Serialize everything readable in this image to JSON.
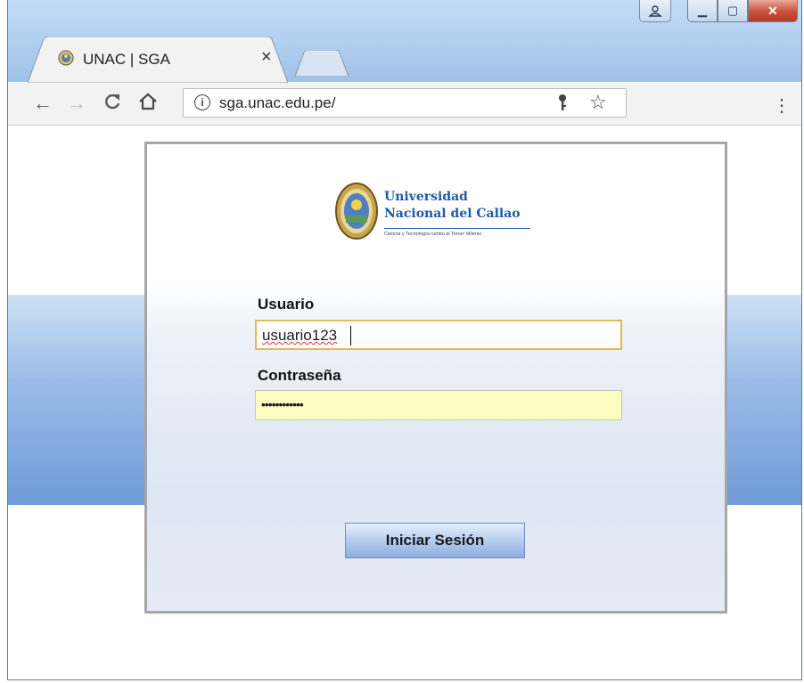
{
  "browser": {
    "tab_title": "UNAC | SGA",
    "tab_close": "×",
    "url": "sga.unac.edu.pe/",
    "info_icon": "i",
    "window_controls": {
      "minimize": "▁",
      "maximize": "▢",
      "close": "✕"
    }
  },
  "logo": {
    "line1": "Universidad",
    "line2": "Nacional del Callao",
    "motto": "Ciencia y Tecnología rumbo al Tercer Milenio"
  },
  "form": {
    "user_label": "Usuario",
    "user_value": "usuario123",
    "password_label": "Contraseña",
    "password_value": "••••••••••••",
    "submit_label": "Iniciar Sesión"
  },
  "colors": {
    "band": "#6f9bd8",
    "button": "#b5ccec",
    "password_autofill": "#fdfdc2",
    "focus_border": "#e3b85a"
  },
  "icons": [
    "favicon-seal-icon",
    "back-arrow-icon",
    "forward-arrow-icon",
    "reload-icon",
    "home-icon",
    "info-icon",
    "key-icon",
    "star-icon",
    "menu-dots-icon",
    "user-icon"
  ]
}
